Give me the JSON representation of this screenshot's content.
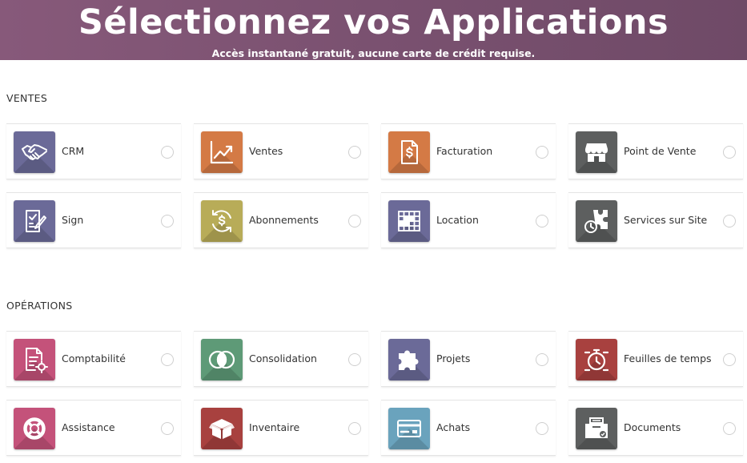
{
  "header": {
    "title": "Sélectionnez vos Applications",
    "subtitle": "Accès instantané gratuit, aucune carte de crédit requise."
  },
  "sections": [
    {
      "title": "VENTES",
      "apps": [
        {
          "label": "CRM",
          "icon": "handshake-icon",
          "color": "#6b6a98"
        },
        {
          "label": "Ventes",
          "icon": "trend-chart-icon",
          "color": "#d47a45"
        },
        {
          "label": "Facturation",
          "icon": "invoice-icon",
          "color": "#d47a45"
        },
        {
          "label": "Point de Vente",
          "icon": "shop-icon",
          "color": "#5d5f5f"
        },
        {
          "label": "Sign",
          "icon": "sign-document-icon",
          "color": "#6b6a98"
        },
        {
          "label": "Abonnements",
          "icon": "subscription-dollar-icon",
          "color": "#b8ac58"
        },
        {
          "label": "Location",
          "icon": "planning-grid-icon",
          "color": "#6b6a98"
        },
        {
          "label": "Services sur Site",
          "icon": "puzzle-timer-icon",
          "color": "#5d5f5f"
        }
      ]
    },
    {
      "title": "OPÉRATIONS",
      "apps": [
        {
          "label": "Comptabilité",
          "icon": "accounting-document-icon",
          "color": "#c4527a"
        },
        {
          "label": "Consolidation",
          "icon": "venn-circles-icon",
          "color": "#5e9a77"
        },
        {
          "label": "Projets",
          "icon": "puzzle-piece-icon",
          "color": "#6b6a98"
        },
        {
          "label": "Feuilles de temps",
          "icon": "stopwatch-icon",
          "color": "#a8413f"
        },
        {
          "label": "Assistance",
          "icon": "lifebuoy-icon",
          "color": "#c4527a"
        },
        {
          "label": "Inventaire",
          "icon": "box-icon",
          "color": "#a8413f"
        },
        {
          "label": "Achats",
          "icon": "credit-card-icon",
          "color": "#6aa3bd"
        },
        {
          "label": "Documents",
          "icon": "document-box-icon",
          "color": "#5d5f5f"
        }
      ]
    }
  ]
}
